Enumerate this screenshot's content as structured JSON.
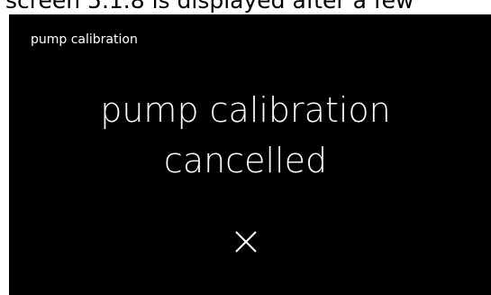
{
  "caption": {
    "text": "screen 5.1.8 is displayed after a few"
  },
  "screen": {
    "title": "pump calibration",
    "message_line1": "pump calibration",
    "message_line2": "cancelled",
    "close_icon": "close-icon"
  },
  "colors": {
    "screen_background": "#000000",
    "screen_text": "#ffffff",
    "page_background": "#ffffff"
  }
}
